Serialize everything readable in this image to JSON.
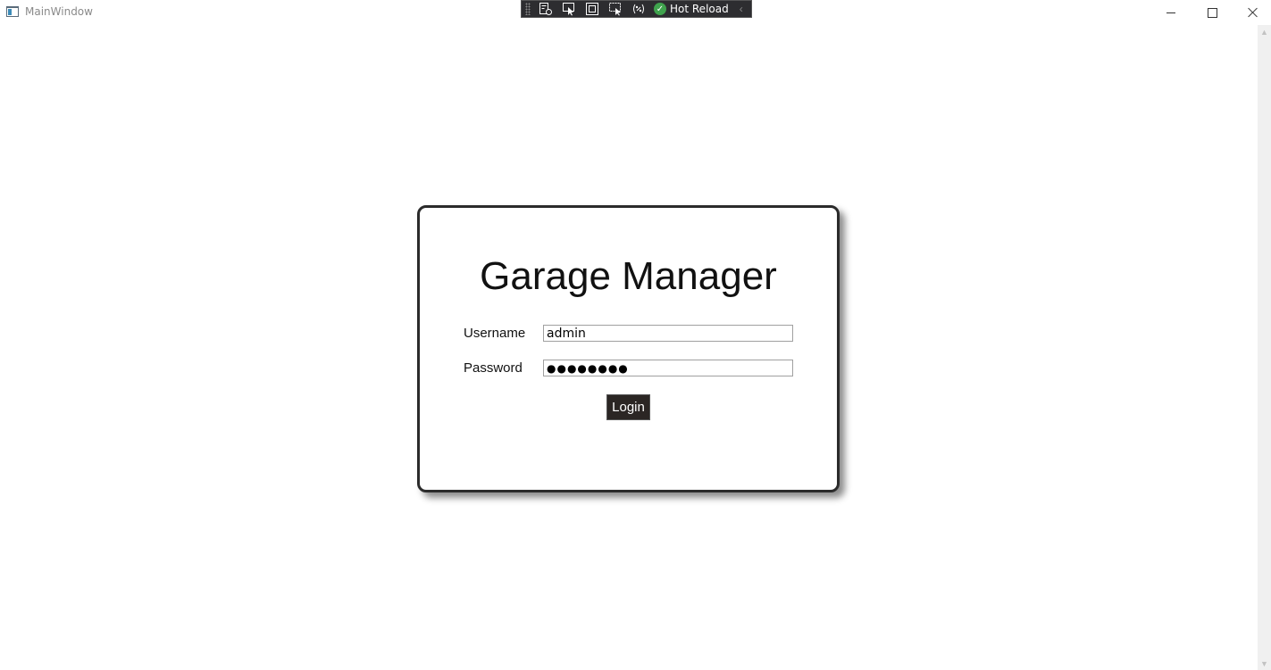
{
  "titlebar": {
    "title": "MainWindow",
    "app_icon": "wpf-window-icon",
    "minimize_icon": "minimize-icon",
    "maximize_icon": "maximize-icon",
    "close_icon": "close-icon"
  },
  "debug_toolbar": {
    "tools": [
      "go-to-live-visual-tree-icon",
      "select-element-icon",
      "display-layout-adorners-icon",
      "track-focused-element-icon",
      "binding-failures-icon"
    ],
    "hot_reload_label": "Hot Reload",
    "hot_reload_status_icon": "check-circle-icon",
    "collapse_icon": "chevron-left-icon"
  },
  "login": {
    "title": "Garage Manager",
    "username_label": "Username",
    "username_value": "admin",
    "password_label": "Password",
    "password_value": "●●●●●●●●",
    "login_button": "Login"
  },
  "colors": {
    "card_border": "#2b2b2b",
    "button_bg": "#2b2624",
    "toolbar_bg": "#2d2d30",
    "hot_reload_ok": "#3fa34d"
  }
}
